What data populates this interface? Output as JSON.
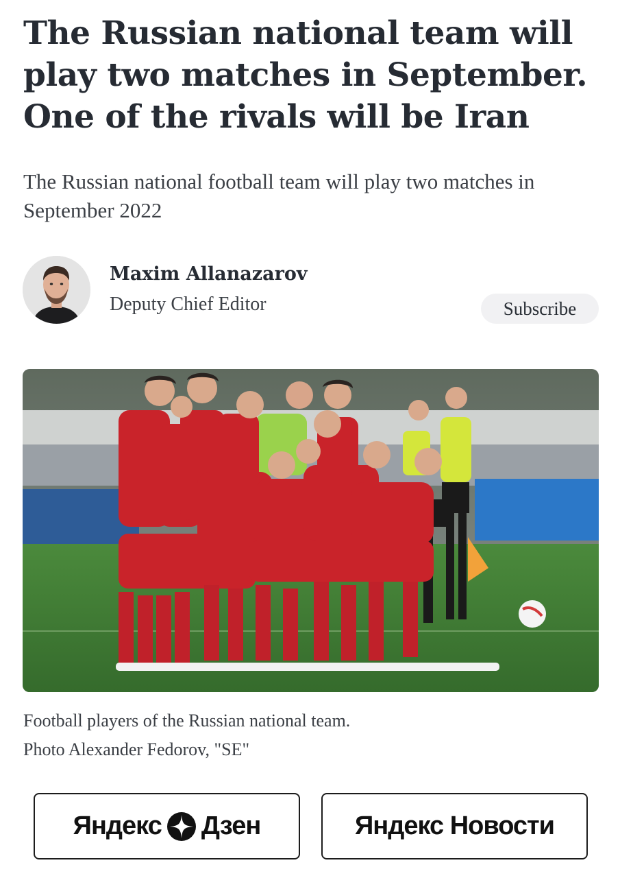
{
  "article": {
    "headline": "The Russian national team will play two matches in September. One of the rivals will be Iran",
    "subtitle": "The Russian national football team will play two matches in September 2022"
  },
  "author": {
    "name": "Maxim Allanazarov",
    "role": "Deputy Chief Editor",
    "subscribe_label": "Subscribe"
  },
  "photo": {
    "caption_line1": "Football players of the Russian national team.",
    "caption_line2": "Photo Alexander Fedorov, \"SE\""
  },
  "share": {
    "dzen_left": "Яндекс",
    "dzen_right": "Дзен",
    "dzen_icon": "dzen-star-icon",
    "news_label": "Яндекс Новости"
  },
  "colors": {
    "text": "#262b33",
    "button_bg": "#f1f1f3",
    "jersey_red": "#c9232a",
    "pitch_green": "#3f7a34"
  }
}
